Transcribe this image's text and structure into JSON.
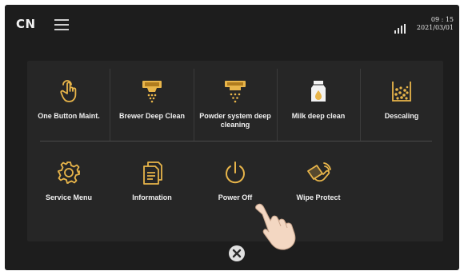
{
  "statusbar": {
    "language": "CN",
    "time": "09 : 15",
    "date": "2021/03/01",
    "menu_icon": "hamburger-menu-icon",
    "signal_icon": "signal-strength-icon"
  },
  "colors": {
    "screen_bg": "#1d1d1d",
    "panel_bg": "#262626",
    "icon_accent": "#e8b54a",
    "text": "#f0f0f0"
  },
  "maintenance": {
    "row1": [
      {
        "label": "One Button Maint.",
        "icon": "hand-touch-icon"
      },
      {
        "label": "Brewer Deep Clean",
        "icon": "coffee-brewer-icon"
      },
      {
        "label": "Powder system deep cleaning",
        "icon": "powder-dispenser-icon"
      },
      {
        "label": "Milk deep clean",
        "icon": "milk-carton-icon"
      },
      {
        "label": "Descaling",
        "icon": "descaling-beaker-icon"
      }
    ],
    "row2": [
      {
        "label": "Service Menu",
        "icon": "gear-icon"
      },
      {
        "label": "Information",
        "icon": "document-icon"
      },
      {
        "label": "Power Off",
        "icon": "power-icon"
      },
      {
        "label": "Wipe Protect",
        "icon": "wipe-hand-icon"
      }
    ]
  },
  "overlay": {
    "close_icon": "close-icon",
    "pointer_icon": "pointing-hand-icon"
  }
}
